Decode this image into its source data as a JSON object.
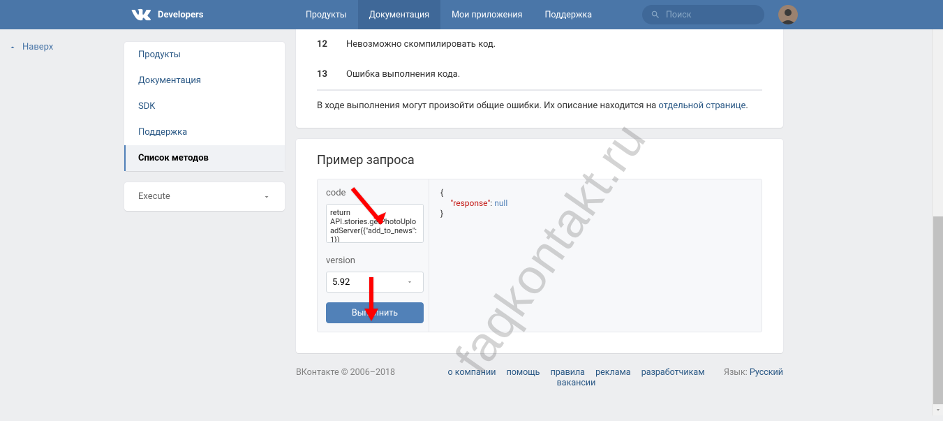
{
  "topbar": {
    "brand": "Developers",
    "tabs": {
      "products": "Продукты",
      "docs": "Документация",
      "apps": "Мои приложения",
      "support": "Поддержка"
    },
    "search_placeholder": "Поиск"
  },
  "leftcol": {
    "up": "Наверх"
  },
  "sidebar": {
    "items": {
      "products": "Продукты",
      "docs": "Документация",
      "sdk": "SDK",
      "support": "Поддержка",
      "methods": "Список методов"
    },
    "execute": "Execute"
  },
  "errors": {
    "rows": [
      {
        "code": "12",
        "desc": "Невозможно скомпилировать код."
      },
      {
        "code": "13",
        "desc": "Ошибка выполнения кода."
      }
    ],
    "note_pre": "В ходе выполнения могут произойти общие ошибки. Их описание находится на ",
    "note_link": "отдельной странице",
    "note_post": "."
  },
  "example": {
    "title": "Пример запроса",
    "code_label": "code",
    "code_value": "return API.stories.getPhotoUploadServer({\"add_to_news\":1})",
    "version_label": "version",
    "version_value": "5.92",
    "run": "Выполнить",
    "response_brace_open": "{",
    "response_key": "\"response\"",
    "response_colon": ": ",
    "response_val": "null",
    "response_brace_close": "}"
  },
  "footer": {
    "copy": "ВКонтакте © 2006–2018",
    "links": {
      "about": "о компании",
      "help": "помощь",
      "rules": "правила",
      "ads": "реклама",
      "devs": "разработчикам",
      "jobs": "вакансии"
    },
    "lang_label": "Язык: ",
    "lang_value": "Русский"
  },
  "watermark": "faqkontakt.ru"
}
